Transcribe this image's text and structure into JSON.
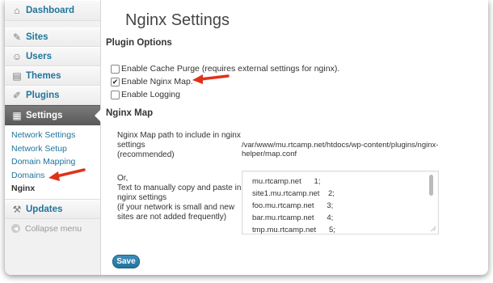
{
  "sidebar": {
    "items": [
      {
        "label": "Dashboard",
        "icon": "home-icon",
        "glyph": "⌂"
      },
      {
        "label": "Sites",
        "icon": "sites-icon",
        "glyph": "✎"
      },
      {
        "label": "Users",
        "icon": "users-icon",
        "glyph": "☺"
      },
      {
        "label": "Themes",
        "icon": "themes-icon",
        "glyph": "▤"
      },
      {
        "label": "Plugins",
        "icon": "plugins-icon",
        "glyph": "✐"
      },
      {
        "label": "Settings",
        "icon": "settings-icon",
        "glyph": "▦"
      }
    ],
    "submenu": [
      "Network Settings",
      "Network Setup",
      "Domain Mapping",
      "Domains",
      "Nginx"
    ],
    "updates": {
      "label": "Updates",
      "glyph": "⚒"
    },
    "collapse": "Collapse menu"
  },
  "main": {
    "title": "Nginx Settings",
    "plugin_options_heading": "Plugin Options",
    "options": [
      {
        "label": "Enable Cache Purge (requires external settings for nginx).",
        "checked": false
      },
      {
        "label": "Enable Nginx Map.",
        "checked": true
      },
      {
        "label": "Enable Logging",
        "checked": false
      }
    ],
    "nginx_map_heading": "Nginx Map",
    "map_path_label": [
      "Nginx Map path to include in nginx",
      "settings",
      "(recommended)"
    ],
    "map_path_value": "/var/www/mu.rtcamp.net/htdocs/wp-content/plugins/nginx-helper/map.conf",
    "manual_label": [
      "Or,",
      "Text to manually copy and paste in",
      "nginx settings",
      "(if your network is small and new",
      "sites are not added frequently)"
    ],
    "map_lines": [
      "mu.rtcamp.net      1;",
      "site1.mu.rtcamp.net    2;",
      "foo.mu.rtcamp.net      3;",
      "bar.mu.rtcamp.net      4;",
      "tmp.mu.rtcamp.net      5;"
    ],
    "save_label": "Save"
  },
  "colors": {
    "link": "#21759b",
    "active_menu": "#6a6a6a",
    "arrow": "#e0321b"
  }
}
